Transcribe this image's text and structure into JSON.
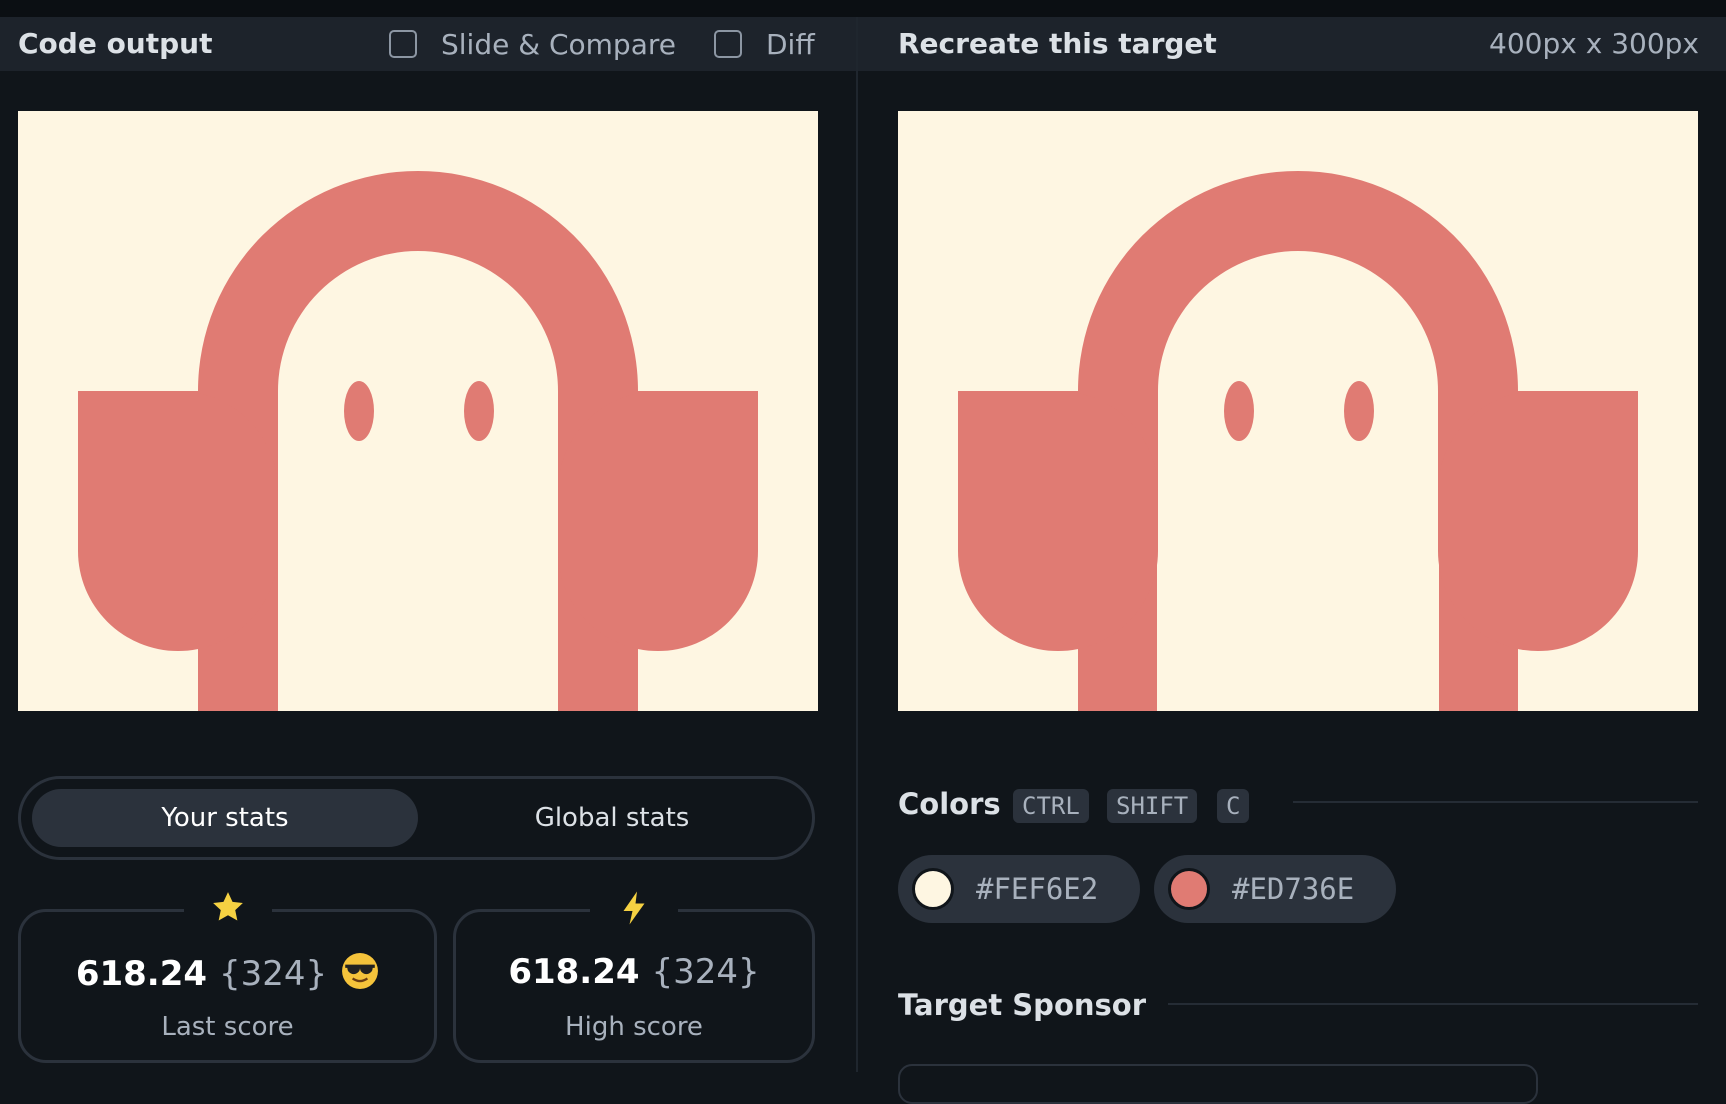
{
  "left_panel": {
    "title": "Code output",
    "slide_compare_label": "Slide & Compare",
    "diff_label": "Diff"
  },
  "right_panel": {
    "title": "Recreate this target",
    "dimensions": "400px x 300px"
  },
  "stats": {
    "tabs": [
      "Your stats",
      "Global stats"
    ],
    "active_tab": "Your stats",
    "last": {
      "icon": "star-icon",
      "value": "618.24",
      "rank": "{324}",
      "emoji": "sunglasses-emoji-icon",
      "label": "Last score"
    },
    "high": {
      "icon": "lightning-icon",
      "value": "618.24",
      "rank": "{324}",
      "label": "High score"
    }
  },
  "colors": {
    "title": "Colors",
    "shortcut_keys": [
      "CTRL",
      "SHIFT",
      "C"
    ],
    "swatches": [
      {
        "hex": "#FEF6E2",
        "color": "#fef6e2"
      },
      {
        "hex": "#ED736E",
        "color": "#e07b73"
      }
    ]
  },
  "sponsor": {
    "title": "Target Sponsor"
  },
  "palette": {
    "background": "#10151a",
    "header": "#1d232b",
    "canvas_bg": "#fef6e2",
    "shape": "#e07b73",
    "star": "#f5d142",
    "bolt": "#f5d142"
  }
}
